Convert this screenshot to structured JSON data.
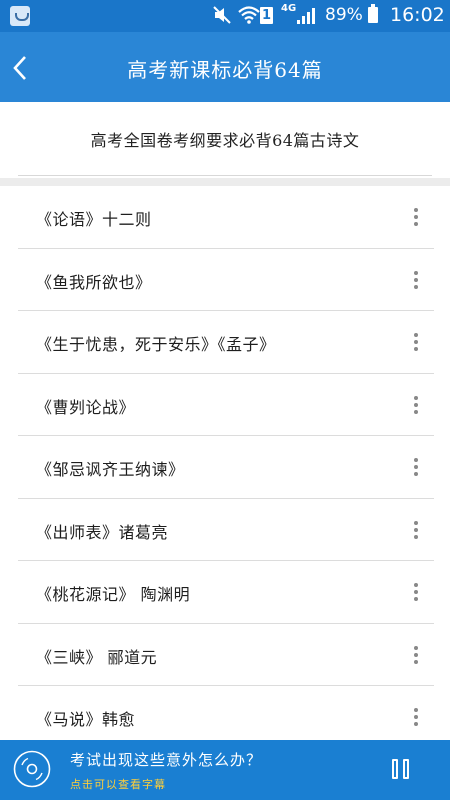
{
  "status_bar": {
    "app_icon": "app-icon",
    "icons": [
      "mute-icon",
      "wifi-icon",
      "sim-icon",
      "signal-icon",
      "battery-icon"
    ],
    "sim_label": "1",
    "network": "4G",
    "battery": "89%",
    "time": "16:02"
  },
  "header": {
    "back_icon": "chevron-left-icon",
    "title": "高考新课标必背64篇"
  },
  "subtitle": "高考全国卷考纲要求必背64篇古诗文",
  "poems": [
    {
      "label": "《论语》十二则"
    },
    {
      "label": "《鱼我所欲也》"
    },
    {
      "label": "《生于忧患，死于安乐》《孟子》"
    },
    {
      "label": "《曹刿论战》"
    },
    {
      "label": "《邹忌讽齐王纳谏》"
    },
    {
      "label": "《出师表》诸葛亮"
    },
    {
      "label": "《桃花源记》 陶渊明"
    },
    {
      "label": "《三峡》 郦道元"
    },
    {
      "label": "《马说》韩愈"
    }
  ],
  "player": {
    "disc_icon": "disc-icon",
    "title": "考试出现这些意外怎么办？",
    "hint": "点击可以查看字幕",
    "control_icon": "pause-icon"
  },
  "colors": {
    "status_bar": "#1a76c9",
    "header": "#2a86d6",
    "player": "#1a7fd2",
    "hint_text": "#ffcf3a"
  }
}
